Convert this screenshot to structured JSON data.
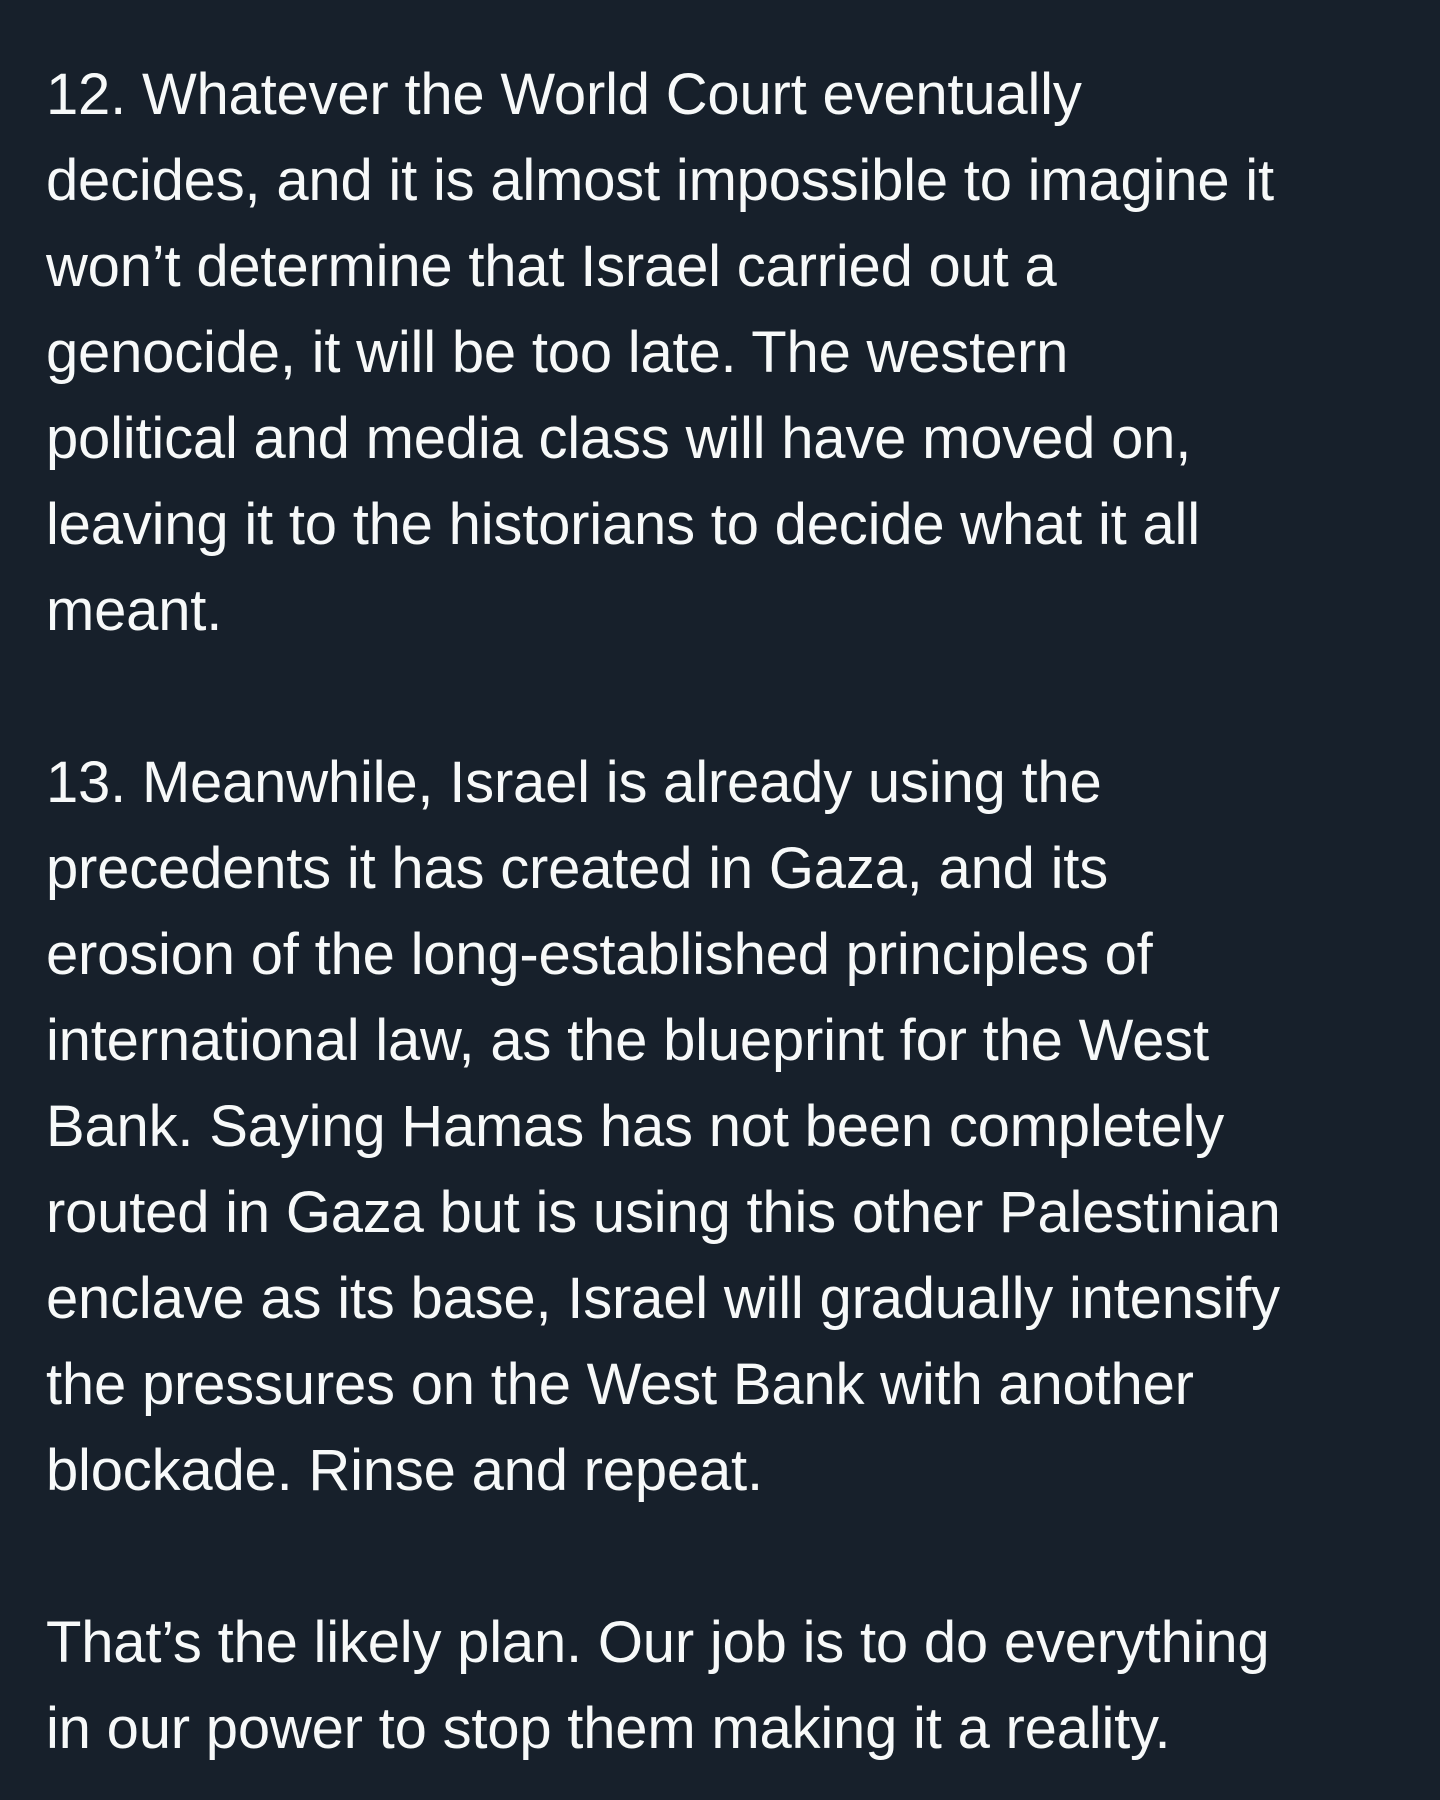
{
  "post": {
    "paragraphs": [
      "12. Whatever the World Court eventually\ndecides, and it is almost impossible to imagine it\nwon’t determine that Israel carried out a\ngenocide, it will be too late. The western\npolitical and media class will have moved on,\nleaving it to the historians to decide what it all\nmeant.",
      "13. Meanwhile, Israel is already using the\nprecedents it has created in Gaza, and its\nerosion of the long-established principles of\ninternational law, as the blueprint for the West\nBank. Saying Hamas has not been completely\nrouted in Gaza but is using this other Palestinian\nenclave as its base, Israel will gradually intensify\nthe pressures on the West Bank with another\nblockade. Rinse and repeat.",
      "That’s the likely plan. Our job is to do everything\nin our power to stop them making it a reality."
    ]
  }
}
